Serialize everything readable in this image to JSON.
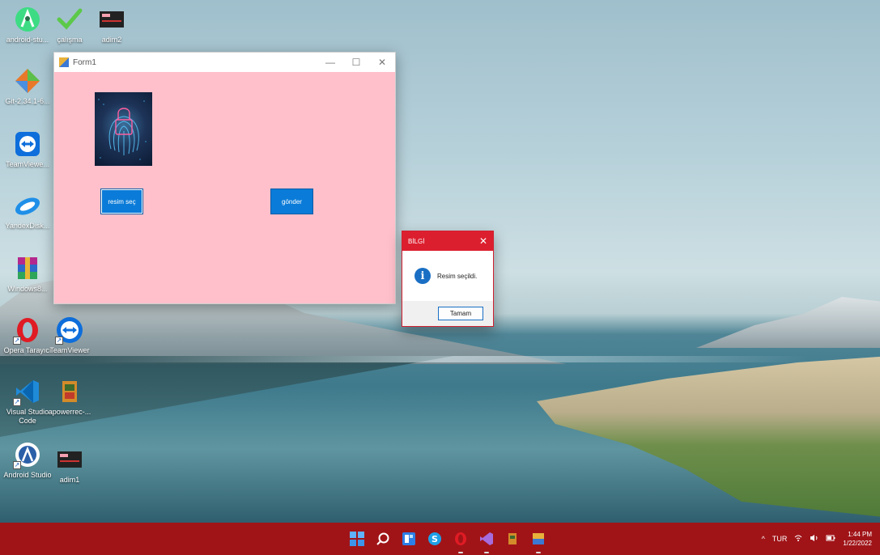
{
  "desktop": {
    "icons": [
      {
        "label": "android-stu...",
        "icon": "android-studio-icon"
      },
      {
        "label": "çalışma",
        "icon": "checkmark-icon"
      },
      {
        "label": "adim2",
        "icon": "app-thumbnail-icon"
      },
      {
        "label": "Git-2.34.1-6...",
        "icon": "git-icon"
      },
      {
        "label": "TeamViewe...",
        "icon": "teamviewer-icon"
      },
      {
        "label": "YandexDisk...",
        "icon": "yandex-disk-icon"
      },
      {
        "label": "Windows8...",
        "icon": "winrar-icon"
      },
      {
        "label": "Opera Tarayıcı",
        "icon": "opera-icon"
      },
      {
        "label": "TeamViewer",
        "icon": "teamviewer-icon"
      },
      {
        "label": "Visual Studio Code",
        "icon": "vscode-icon"
      },
      {
        "label": "apowerrec-...",
        "icon": "apowerrec-icon"
      },
      {
        "label": "Android Studio",
        "icon": "android-studio-icon"
      },
      {
        "label": "adim1",
        "icon": "app-thumbnail-icon"
      }
    ]
  },
  "form1": {
    "title": "Form1",
    "bg_color": "#ffc0cb",
    "controls": {
      "minimize": "—",
      "maximize": "☐",
      "close": "✕"
    },
    "buttons": {
      "select_image": "resim seç",
      "send": "gönder"
    }
  },
  "msgbox": {
    "title": "BİLGİ",
    "close": "✕",
    "icon": "info-icon",
    "message": "Resim seçildi.",
    "ok_label": "Tamam"
  },
  "taskbar": {
    "color": "#a01418",
    "apps": [
      "start-icon",
      "search-icon",
      "widgets-icon",
      "skype-icon",
      "opera-icon",
      "visual-studio-icon",
      "apowerrec-icon",
      "winforms-app-icon"
    ],
    "tray": {
      "chevron": "^",
      "language": "TUR",
      "time": "1:44 PM",
      "date": "1/22/2022"
    }
  }
}
